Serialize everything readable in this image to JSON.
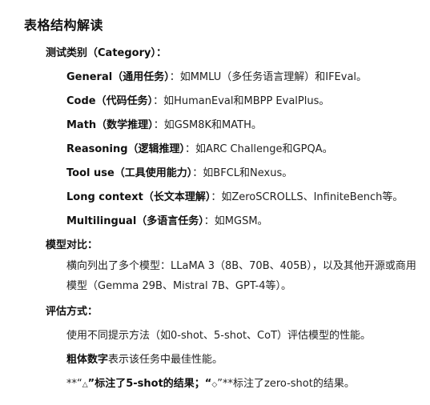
{
  "title": "表格结构解读",
  "sections": {
    "categories": {
      "heading": "测试类别（Category）：",
      "items": [
        {
          "label": "General（通用任务）",
          "text": "：如MMLU（多任务语言理解）和IFEval。"
        },
        {
          "label": "Code（代码任务）",
          "text": "：如HumanEval和MBPP EvalPlus。"
        },
        {
          "label": "Math（数学推理）",
          "text": "：如GSM8K和MATH。"
        },
        {
          "label": "Reasoning（逻辑推理）",
          "text": "：如ARC Challenge和GPQA。"
        },
        {
          "label": "Tool use（工具使用能力）",
          "text": "：如BFCL和Nexus。"
        },
        {
          "label": "Long context（长文本理解）",
          "text": "：如ZeroSCROLLS、InfiniteBench等。"
        },
        {
          "label": "Multilingual（多语言任务）",
          "text": "：如MGSM。"
        }
      ]
    },
    "comparison": {
      "heading": "模型对比：",
      "text": "横向列出了多个模型：LLaMA 3（8B、70B、405B），以及其他开源或商用模型（Gemma 29B、Mistral 7B、GPT-4等）。"
    },
    "evaluation": {
      "heading": "评估方式：",
      "line1": "使用不同提示方法（如0-shot、5-shot、CoT）评估模型的性能。",
      "line2_bold": "粗体数字",
      "line2_rest": "表示该任务中最佳性能。",
      "line3_prefix": "**“",
      "line3_symbol1": "△",
      "line3_mid": "”标注了5-shot的结果；“",
      "line3_symbol2": "◇",
      "line3_rest": "”**标注了zero-shot的结果。"
    }
  }
}
